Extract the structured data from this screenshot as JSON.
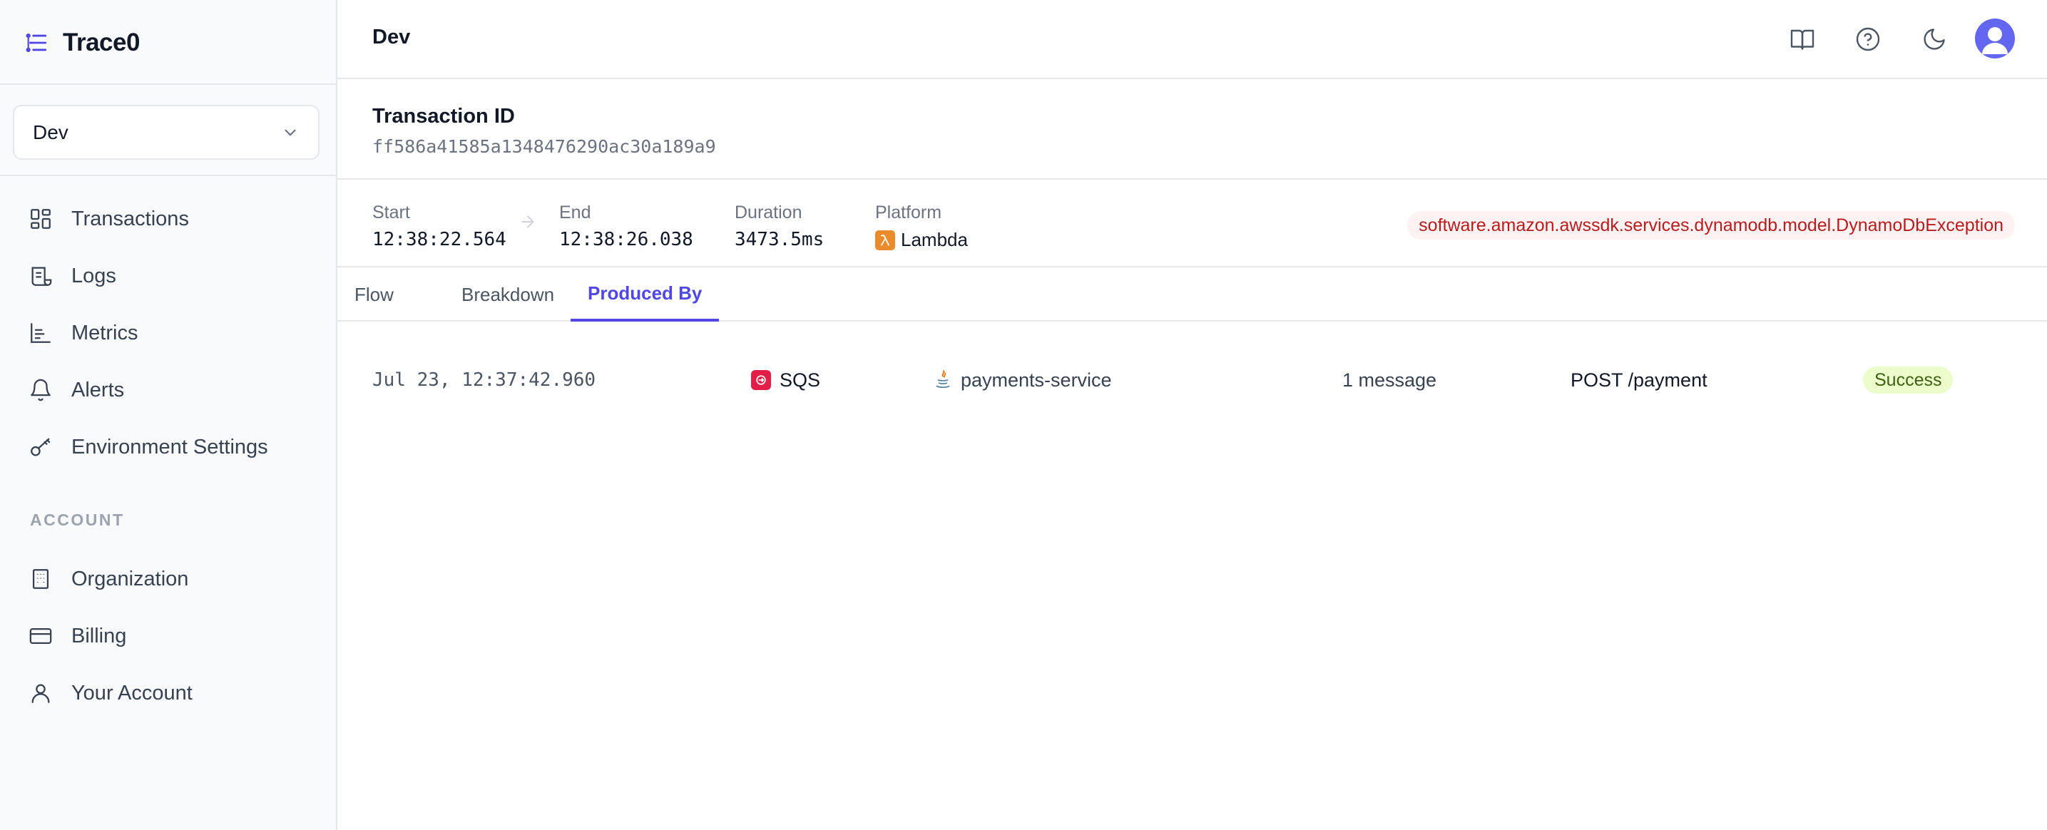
{
  "app": {
    "brand": "Trace0",
    "environment": "Dev",
    "accent": "#4f46e5"
  },
  "sidebar": {
    "items": [
      {
        "label": "Transactions",
        "icon": "grid-icon"
      },
      {
        "label": "Logs",
        "icon": "scroll-icon"
      },
      {
        "label": "Metrics",
        "icon": "bar-chart-icon"
      },
      {
        "label": "Alerts",
        "icon": "bell-icon"
      },
      {
        "label": "Environment Settings",
        "icon": "key-icon"
      }
    ],
    "account_section": "ACCOUNT",
    "account_items": [
      {
        "label": "Organization",
        "icon": "building-icon"
      },
      {
        "label": "Billing",
        "icon": "credit-card-icon"
      },
      {
        "label": "Your Account",
        "icon": "user-icon"
      }
    ]
  },
  "header": {
    "title": "Dev",
    "icons": [
      "book-icon",
      "help-icon",
      "moon-icon",
      "avatar"
    ]
  },
  "transaction": {
    "id_label": "Transaction ID",
    "id": "ff586a41585a1348476290ac30a189a9",
    "start_label": "Start",
    "start": "12:38:22.564",
    "end_label": "End",
    "end": "12:38:26.038",
    "duration_label": "Duration",
    "duration": "3473.5ms",
    "platform_label": "Platform",
    "platform": "Lambda",
    "exception": "software.amazon.awssdk.services.dynamodb.model.DynamoDbException"
  },
  "tabs": [
    {
      "label": "Flow",
      "active": false
    },
    {
      "label": "Breakdown",
      "active": false
    },
    {
      "label": "Produced By",
      "active": true
    }
  ],
  "produced_by": [
    {
      "timestamp": "Jul 23, 12:37:42.960",
      "source": "SQS",
      "service": "payments-service",
      "messages": "1 message",
      "route": "POST /payment",
      "status": "Success"
    }
  ]
}
